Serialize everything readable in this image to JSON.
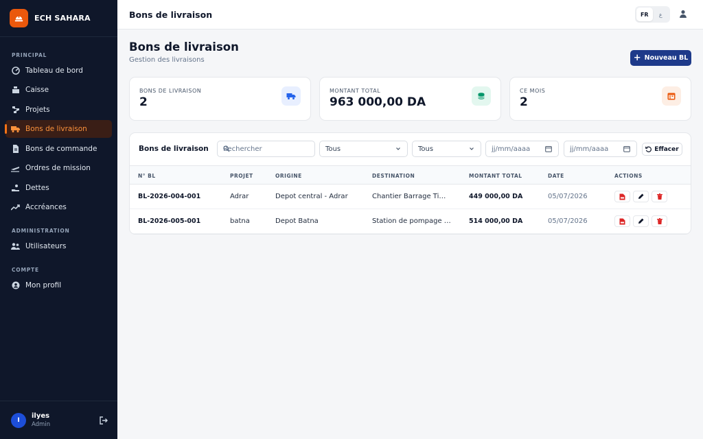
{
  "app": {
    "name": "ECH SAHARA"
  },
  "sidebar": {
    "sections": {
      "principal": "PRINCIPAL",
      "administration": "ADMINISTRATION",
      "compte": "COMPTE"
    },
    "items": [
      {
        "label": "Tableau de bord",
        "icon": "dashboard-icon"
      },
      {
        "label": "Caisse",
        "icon": "cash-register-icon"
      },
      {
        "label": "Projets",
        "icon": "projects-icon"
      },
      {
        "label": "Bons de livraison",
        "icon": "truck-icon",
        "active": true
      },
      {
        "label": "Bons de commande",
        "icon": "document-icon"
      },
      {
        "label": "Ordres de mission",
        "icon": "plane-icon"
      },
      {
        "label": "Dettes",
        "icon": "hand-money-icon"
      },
      {
        "label": "Accréances",
        "icon": "trend-up-icon"
      },
      {
        "label": "Utilisateurs",
        "icon": "users-icon"
      },
      {
        "label": "Mon profil",
        "icon": "user-circle-icon"
      }
    ],
    "user": {
      "initial": "I",
      "name": "ilyes",
      "role": "Admin"
    }
  },
  "topbar": {
    "title": "Bons de livraison",
    "lang_active": "FR",
    "lang_other": "ع"
  },
  "page": {
    "title": "Bons de livraison",
    "subtitle": "Gestion des livraisons",
    "new_button": "Nouveau BL"
  },
  "stats": [
    {
      "label": "BONS DE LIVRAISON",
      "value": "2",
      "icon": "truck-icon",
      "color": "#2563eb"
    },
    {
      "label": "MONTANT TOTAL",
      "value": "963 000,00 DA",
      "icon": "coins-icon",
      "color": "#059669"
    },
    {
      "label": "CE MOIS",
      "value": "2",
      "icon": "calendar-icon",
      "color": "#ea580c"
    }
  ],
  "table": {
    "title": "Bons de livraison",
    "search_placeholder": "Rechercher",
    "filter1": "Tous",
    "filter2": "Tous",
    "date_from_placeholder": "jj/mm/aaaa",
    "date_to_placeholder": "jj/mm/aaaa",
    "clear_button": "Effacer",
    "columns": [
      "N° BL",
      "PROJET",
      "ORIGINE",
      "DESTINATION",
      "MONTANT TOTAL",
      "DATE",
      "ACTIONS"
    ],
    "rows": [
      {
        "num": "BL-2026-004-001",
        "projet": "Adrar",
        "origine": "Depot central - Adrar",
        "destination": "Chantier Barrage Timimoun",
        "montant": "449 000,00 DA",
        "date": "05/07/2026"
      },
      {
        "num": "BL-2026-005-001",
        "projet": "batna",
        "origine": "Depot Batna",
        "destination": "Station de pompage - Batna",
        "montant": "514 000,00 DA",
        "date": "05/07/2026"
      }
    ]
  },
  "colors": {
    "sidebar_bg": "#0f172a",
    "accent": "#f97316",
    "primary": "#1e3a8a",
    "danger": "#dc2626"
  }
}
